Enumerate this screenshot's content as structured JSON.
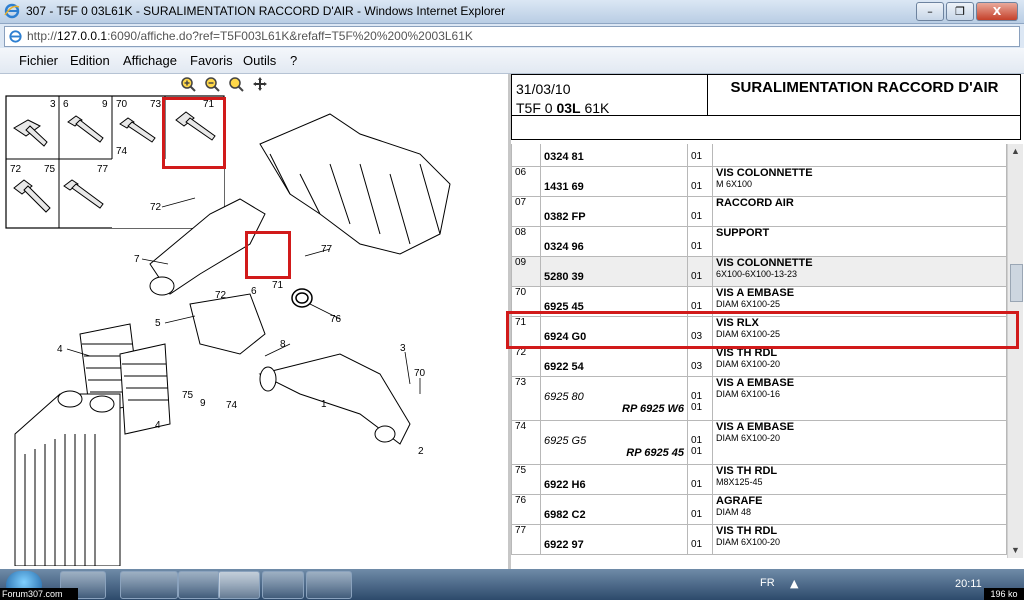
{
  "window": {
    "title": "307 - T5F 0 03L61K - SURALIMENTATION RACCORD D'AIR - Windows Internet Explorer",
    "minimize": "–",
    "maximize": "❐",
    "close": "X"
  },
  "address": {
    "scheme": "http://",
    "host": "127.0.0.1",
    "rest": ":6090/affiche.do?ref=T5F003L61K&refaff=T5F%20%200%2003L61K"
  },
  "menu": [
    "Fichier",
    "Edition",
    "Affichage",
    "Favoris",
    "Outils",
    "?"
  ],
  "header": {
    "date": "31/03/10",
    "code_prefix": "T5F 0 ",
    "code_bold": "03L",
    "code_suffix": " 61K",
    "title": "SURALIMENTATION RACCORD D'AIR"
  },
  "diagram": {
    "thumbs": [
      {
        "nums": [
          "3"
        ]
      },
      {
        "nums": [
          "6",
          "9"
        ]
      },
      {
        "nums": [
          "70",
          "73",
          "74"
        ]
      },
      {
        "nums": [
          "71"
        ]
      },
      {
        "nums": [
          "72",
          "75"
        ]
      },
      {
        "nums": [
          "77"
        ]
      }
    ],
    "callouts": [
      "72",
      "7",
      "5",
      "4",
      "4",
      "75",
      "9",
      "74",
      "6",
      "71",
      "72",
      "77",
      "76",
      "8",
      "3",
      "70",
      "1",
      "2"
    ]
  },
  "parts": [
    {
      "num": "",
      "ref": "0324 81",
      "qty": "01",
      "name": "",
      "sub": "",
      "shaded": false
    },
    {
      "num": "06",
      "ref": "1431 69",
      "qty": "01",
      "name": "VIS COLONNETTE",
      "sub": "M 6X100",
      "shaded": false
    },
    {
      "num": "07",
      "ref": "0382 FP",
      "qty": "01",
      "name": "RACCORD AIR",
      "sub": "",
      "shaded": false
    },
    {
      "num": "08",
      "ref": "0324 96",
      "qty": "01",
      "name": "SUPPORT",
      "sub": "",
      "shaded": false
    },
    {
      "num": "09",
      "ref": "5280 39",
      "qty": "01",
      "name": "VIS COLONNETTE",
      "sub": "6X100-6X100-13-23",
      "shaded": true
    },
    {
      "num": "70",
      "ref": "6925 45",
      "qty": "01",
      "name": "VIS A EMBASE",
      "sub": "DIAM 6X100-25",
      "shaded": false
    },
    {
      "num": "71",
      "ref": "6924 G0",
      "qty": "03",
      "name": "VIS RLX",
      "sub": "DIAM 6X100-25",
      "shaded": false
    },
    {
      "num": "72",
      "ref": "6922 54",
      "qty": "03",
      "name": "VIS TH RDL",
      "sub": "DIAM 6X100-20",
      "shaded": false
    },
    {
      "num": "73",
      "ref_old": "6925 80",
      "ref": "RP 6925 W6",
      "qty_old": "01",
      "qty": "01",
      "name": "VIS A EMBASE",
      "sub": "DIAM 6X100-16",
      "shaded": false
    },
    {
      "num": "74",
      "ref_old": "6925 G5",
      "ref": "RP 6925 45",
      "qty_old": "01",
      "qty": "01",
      "name": "VIS A EMBASE",
      "sub": "DIAM 6X100-20",
      "shaded": false
    },
    {
      "num": "75",
      "ref": "6922 H6",
      "qty": "01",
      "name": "VIS TH RDL",
      "sub": "M8X125-45",
      "shaded": false
    },
    {
      "num": "76",
      "ref": "6982 C2",
      "qty": "01",
      "name": "AGRAFE",
      "sub": "DIAM 48",
      "shaded": false
    },
    {
      "num": "77",
      "ref": "6922 97",
      "qty": "01",
      "name": "VIS TH RDL",
      "sub": "DIAM 6X100-20",
      "shaded": false
    }
  ],
  "taskbar": {
    "lang": "FR",
    "clock": "20:11",
    "forum": "Forum307.com",
    "size": "196 ko"
  },
  "colors": {
    "highlight": "#d11a1a",
    "titlebar": "#c9d9ec",
    "taskbar": "#3f5f82"
  }
}
